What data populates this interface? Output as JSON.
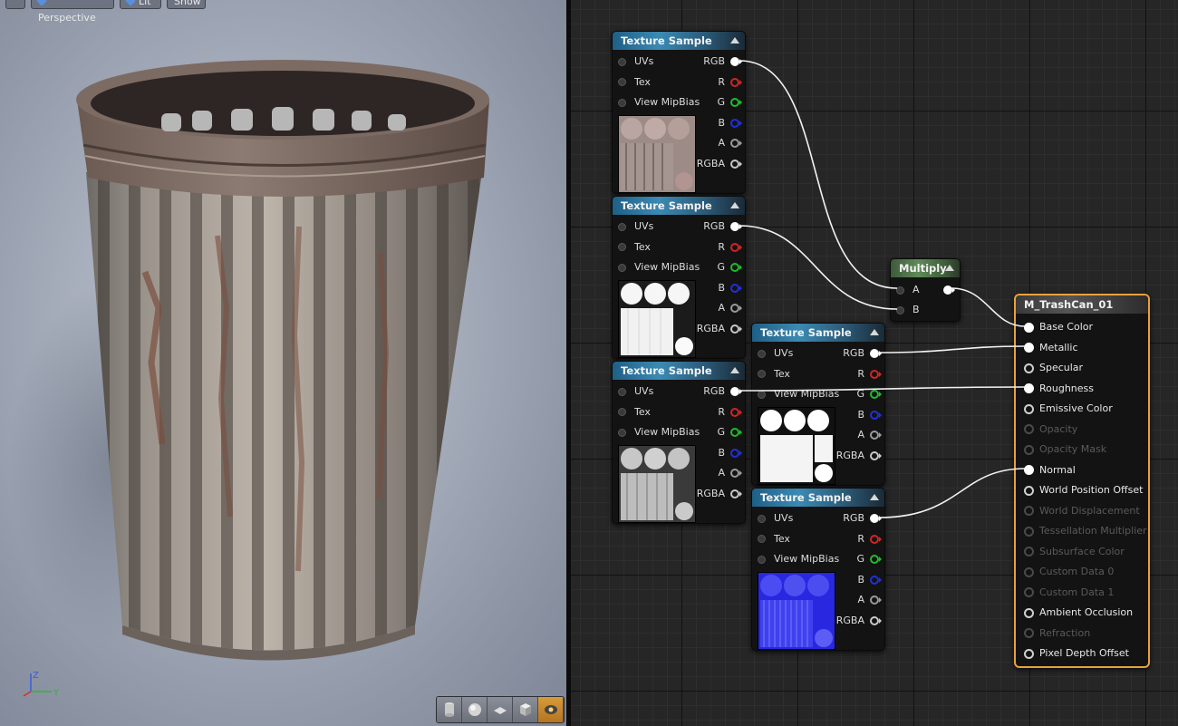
{
  "viewport": {
    "toolbar": [
      "",
      "Perspective",
      "Lit",
      "Show"
    ],
    "axis": {
      "z": "Z",
      "y": "Y"
    },
    "tools": [
      "cylinder-preview-icon",
      "sphere-preview-icon",
      "plane-preview-icon",
      "cube-preview-icon",
      "custom-mesh-preview-icon"
    ]
  },
  "texture_nodes": [
    {
      "title": "Texture Sample",
      "inputs": [
        "UVs",
        "Tex",
        "View MipBias"
      ],
      "outputs": [
        "RGB",
        "R",
        "G",
        "B",
        "A",
        "RGBA"
      ],
      "thumbnail": "base-color-texture"
    },
    {
      "title": "Texture Sample",
      "inputs": [
        "UVs",
        "Tex",
        "View MipBias"
      ],
      "outputs": [
        "RGB",
        "R",
        "G",
        "B",
        "A",
        "RGBA"
      ],
      "thumbnail": "ao-mask-texture"
    },
    {
      "title": "Texture Sample",
      "inputs": [
        "UVs",
        "Tex",
        "View MipBias"
      ],
      "outputs": [
        "RGB",
        "R",
        "G",
        "B",
        "A",
        "RGBA"
      ],
      "thumbnail": "roughness-texture"
    },
    {
      "title": "Texture Sample",
      "inputs": [
        "UVs",
        "Tex",
        "View MipBias"
      ],
      "outputs": [
        "RGB",
        "R",
        "G",
        "B",
        "A",
        "RGBA"
      ],
      "thumbnail": "metallic-texture"
    },
    {
      "title": "Texture Sample",
      "inputs": [
        "UVs",
        "Tex",
        "View MipBias"
      ],
      "outputs": [
        "RGB",
        "R",
        "G",
        "B",
        "A",
        "RGBA"
      ],
      "thumbnail": "normal-map-texture"
    }
  ],
  "multiply": {
    "title": "Multiply",
    "inputs": [
      "A",
      "B"
    ]
  },
  "material": {
    "title": "M_TrashCan_01",
    "inputs": [
      {
        "label": "Base Color",
        "connected": true,
        "enabled": true
      },
      {
        "label": "Metallic",
        "connected": true,
        "enabled": true
      },
      {
        "label": "Specular",
        "connected": false,
        "enabled": true
      },
      {
        "label": "Roughness",
        "connected": true,
        "enabled": true
      },
      {
        "label": "Emissive Color",
        "connected": false,
        "enabled": true
      },
      {
        "label": "Opacity",
        "connected": false,
        "enabled": false
      },
      {
        "label": "Opacity Mask",
        "connected": false,
        "enabled": false
      },
      {
        "label": "Normal",
        "connected": true,
        "enabled": true
      },
      {
        "label": "World Position Offset",
        "connected": false,
        "enabled": true
      },
      {
        "label": "World Displacement",
        "connected": false,
        "enabled": false
      },
      {
        "label": "Tessellation Multiplier",
        "connected": false,
        "enabled": false
      },
      {
        "label": "Subsurface Color",
        "connected": false,
        "enabled": false
      },
      {
        "label": "Custom Data 0",
        "connected": false,
        "enabled": false
      },
      {
        "label": "Custom Data 1",
        "connected": false,
        "enabled": false
      },
      {
        "label": "Ambient Occlusion",
        "connected": false,
        "enabled": true
      },
      {
        "label": "Refraction",
        "connected": false,
        "enabled": false
      },
      {
        "label": "Pixel Depth Offset",
        "connected": false,
        "enabled": true
      }
    ]
  },
  "colors": {
    "accent": "#e8a23c",
    "texture_header": "#2f7fac",
    "multiply_header": "#5f8a58"
  }
}
